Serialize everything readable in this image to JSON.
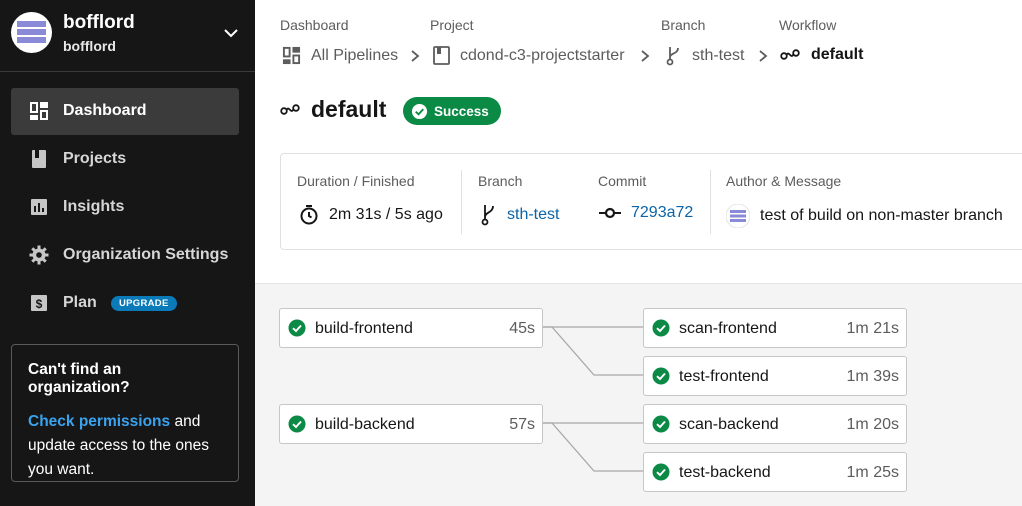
{
  "org": {
    "name": "bofflord",
    "subname": "bofflord"
  },
  "nav": [
    {
      "label": "Dashboard",
      "icon": "dashboard-icon",
      "active": true
    },
    {
      "label": "Projects",
      "icon": "projects-icon"
    },
    {
      "label": "Insights",
      "icon": "insights-icon"
    },
    {
      "label": "Organization Settings",
      "icon": "gear-icon"
    },
    {
      "label": "Plan",
      "icon": "plan-icon",
      "badge": "UPGRADE"
    }
  ],
  "cta": {
    "title": "Can't find an organization?",
    "link": "Check permissions",
    "text": " and update access to the ones you want."
  },
  "breadcrumb": {
    "labels": [
      "Dashboard",
      "Project",
      "Branch",
      "Workflow"
    ],
    "items": [
      "All Pipelines",
      "cdond-c3-projectstarter",
      "sth-test",
      "default"
    ]
  },
  "workflow": {
    "title": "default",
    "status": "Success"
  },
  "summary": {
    "duration_label": "Duration / Finished",
    "duration_value": "2m 31s / 5s ago",
    "branch_label": "Branch",
    "branch_value": "sth-test",
    "commit_label": "Commit",
    "commit_value": "7293a72",
    "author_label": "Author & Message",
    "author_message": "test of build on non-master branch"
  },
  "jobs": [
    {
      "name": "build-frontend",
      "time": "45s",
      "status": "success"
    },
    {
      "name": "build-backend",
      "time": "57s",
      "status": "success"
    },
    {
      "name": "scan-frontend",
      "time": "1m 21s",
      "status": "success"
    },
    {
      "name": "test-frontend",
      "time": "1m 39s",
      "status": "success"
    },
    {
      "name": "scan-backend",
      "time": "1m 20s",
      "status": "success"
    },
    {
      "name": "test-backend",
      "time": "1m 25s",
      "status": "success"
    }
  ],
  "colors": {
    "sidebar": "#161616",
    "success": "#0a8a45",
    "link": "#0b64a8",
    "accent": "#3aa3f0"
  }
}
